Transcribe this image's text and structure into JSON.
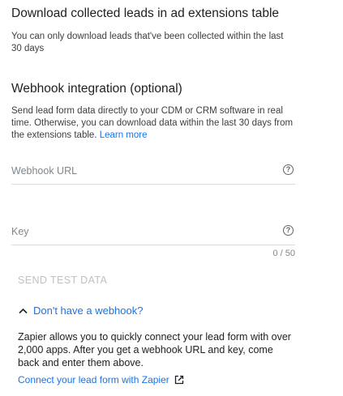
{
  "download_section": {
    "title": "Download collected leads in ad extensions table",
    "description": "You can only download leads that've been collected within the last 30 days"
  },
  "webhook_section": {
    "title": "Webhook integration (optional)",
    "description": "Send lead form data directly to your CDM or CRM software in real time. Otherwise, you can download data within the last 30 days from the extensions table.",
    "learn_more": "Learn more",
    "url_field": {
      "placeholder": "Webhook URL",
      "value": ""
    },
    "key_field": {
      "placeholder": "Key",
      "value": ""
    },
    "key_counter": "0 / 50",
    "send_test_label": "SEND TEST DATA",
    "toggle_label": "Don't have a webhook?",
    "zapier_text": "Zapier allows you to quickly connect your lead form with over 2,000 apps. After you get a webhook URL and key, come back and enter them above.",
    "zapier_link": "Connect your lead form with Zapier"
  },
  "icons": {
    "help": "help-circle-icon",
    "chevron": "chevron-up-icon",
    "external": "open-in-new-icon"
  },
  "colors": {
    "link": "#1a73e8",
    "disabled": "#bdc1c6",
    "divider": "#dadce0"
  }
}
